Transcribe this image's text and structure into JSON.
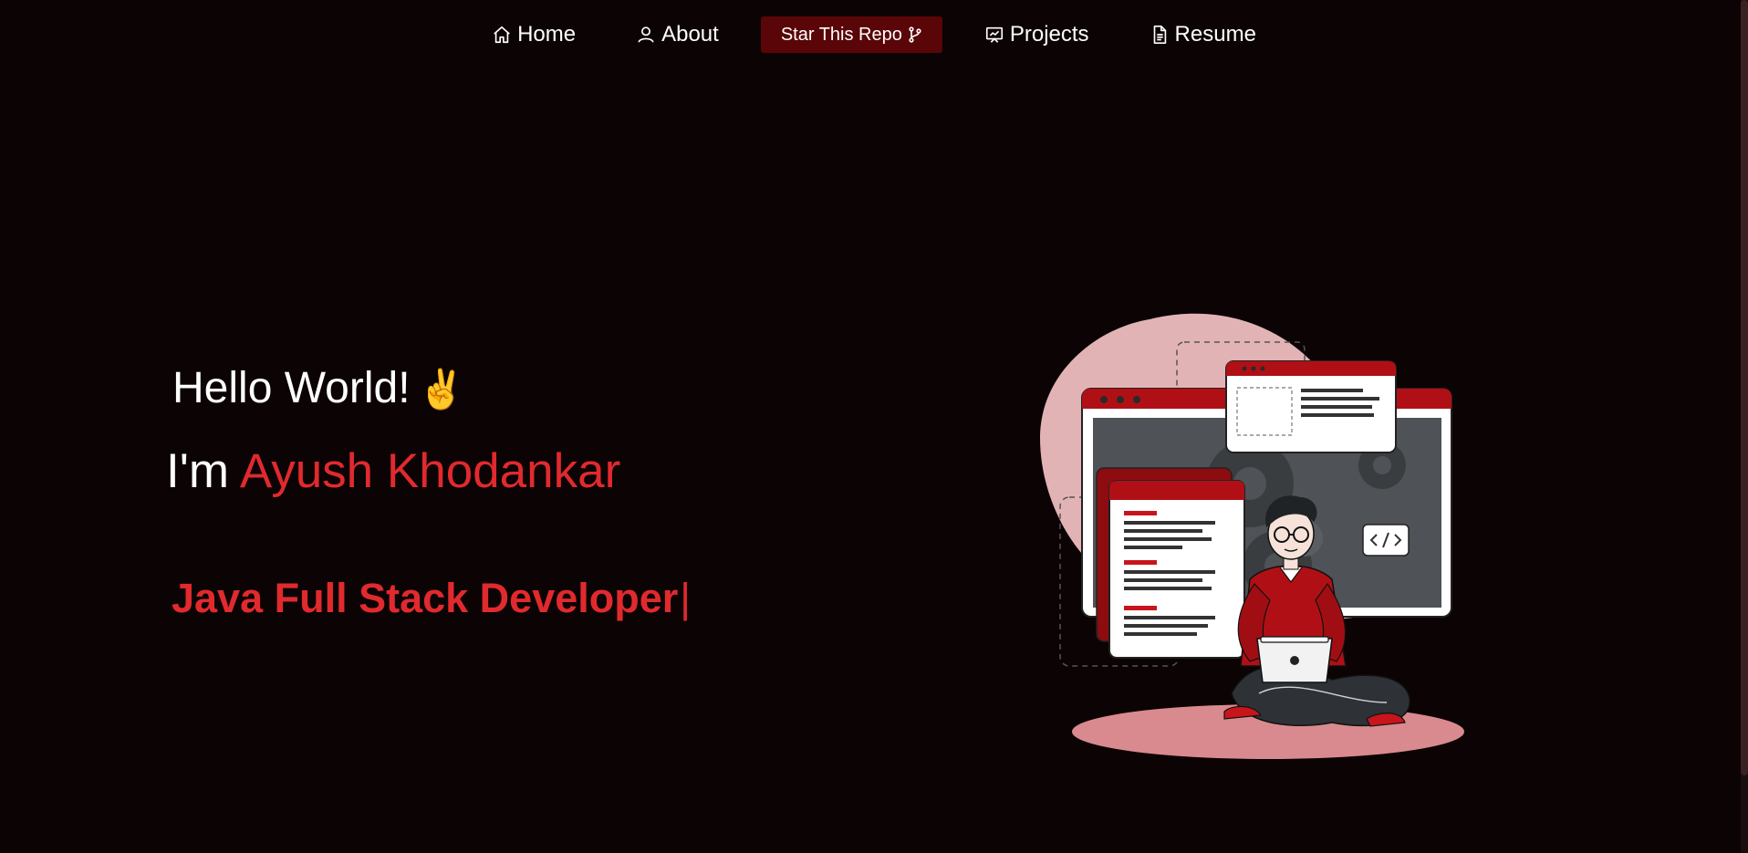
{
  "nav": {
    "home": {
      "label": "Home",
      "icon": "home-icon"
    },
    "about": {
      "label": "About",
      "icon": "user-icon"
    },
    "star": {
      "label": "Star This Repo",
      "icon": "git-fork-icon"
    },
    "projects": {
      "label": "Projects",
      "icon": "presentation-icon"
    },
    "resume": {
      "label": "Resume",
      "icon": "document-icon"
    }
  },
  "hero": {
    "greeting": "Hello World!",
    "greeting_emoji": "✌️",
    "intro": "I'm",
    "name": "Ayush Khodankar",
    "role": "Java Full Stack Developer",
    "cursor": "|"
  },
  "colors": {
    "background": "#0c0304",
    "accent": "#e02a2e",
    "button_bg": "#5a0507",
    "text": "#ffffff"
  }
}
